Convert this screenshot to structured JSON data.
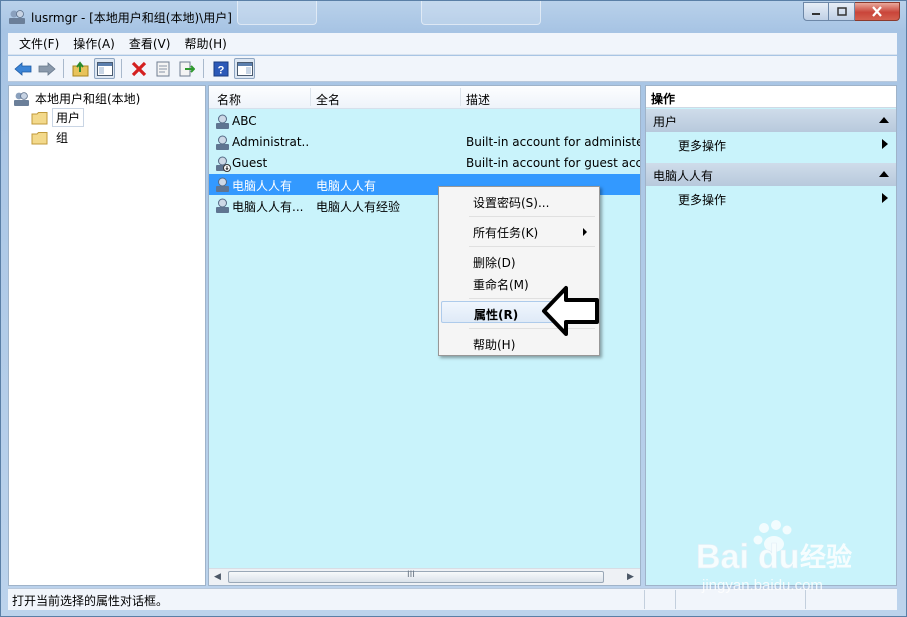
{
  "window": {
    "title": "lusrmgr - [本地用户和组(本地)\\用户]",
    "controls": {
      "minimize": "—",
      "maximize": "□",
      "close": "✕"
    }
  },
  "menubar": [
    {
      "label": "文件(F)"
    },
    {
      "label": "操作(A)"
    },
    {
      "label": "查看(V)"
    },
    {
      "label": "帮助(H)"
    }
  ],
  "toolbar": {
    "buttons": [
      "back-arrow-icon",
      "forward-arrow-icon",
      "up-folder-icon",
      "show-hide-tree-icon",
      "delete-icon",
      "properties-icon",
      "export-list-icon",
      "help-icon",
      "action-pane-icon"
    ]
  },
  "tree": {
    "root": "本地用户和组(本地)",
    "children": [
      {
        "label": "用户",
        "selected": true
      },
      {
        "label": "组",
        "selected": false
      }
    ]
  },
  "list": {
    "columns": [
      "名称",
      "全名",
      "描述"
    ],
    "rows": [
      {
        "name": "ABC",
        "full_name": "",
        "description": "",
        "selected": false
      },
      {
        "name": "Administrat...",
        "full_name": "",
        "description": "Built-in account for administer",
        "selected": false
      },
      {
        "name": "Guest",
        "full_name": "",
        "description": "Built-in account for guest acce",
        "selected": false
      },
      {
        "name": "电脑人人有",
        "full_name": "电脑人人有",
        "description": "",
        "selected": true
      },
      {
        "name": "电脑人人有...",
        "full_name": "电脑人人有经验",
        "description": "",
        "selected": false
      }
    ],
    "scroll_grip": "III"
  },
  "context_menu": {
    "items": [
      {
        "label": "设置密码(S)..."
      },
      {
        "label": "所有任务(K)",
        "submenu": true
      },
      {
        "label": "删除(D)"
      },
      {
        "label": "重命名(M)"
      },
      {
        "label": "属性(R)",
        "default": true
      },
      {
        "label": "帮助(H)"
      }
    ]
  },
  "actions": {
    "title": "操作",
    "groups": [
      {
        "label": "用户",
        "item": "更多操作"
      },
      {
        "label": "电脑人人有",
        "item": "更多操作"
      }
    ]
  },
  "status": {
    "text": "打开当前选择的属性对话框。"
  },
  "watermark": {
    "brand": "Bai",
    "brand2": "du",
    "suffix": "经验",
    "url": "jingyan.baidu.com"
  },
  "colors": {
    "selection": "#3399ff",
    "pane_background": "#c9f3fb",
    "title_gradient": "#b9d1ea"
  }
}
